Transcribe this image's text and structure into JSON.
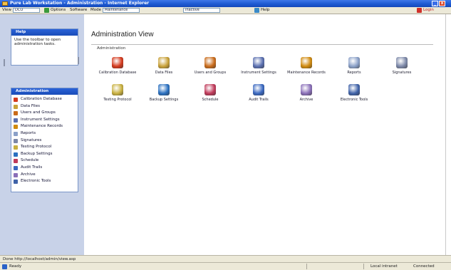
{
  "window": {
    "title": "Pure Lab Workstation - Administration - Internet Explorer",
    "buttons": [
      "_",
      "□",
      "x"
    ]
  },
  "toolbar": {
    "view_label": "View",
    "view_value": "DCO",
    "btn_options": "Options",
    "btn_software": "Software",
    "mode_label": "Mode",
    "mode_value": "Maintenance",
    "select2_value": "Inactive",
    "btn_help": "Help",
    "btn_login": "Login"
  },
  "left": {
    "panel1": {
      "title": "Help",
      "text": "Use the toolbar to open administration tasks."
    },
    "panel2": {
      "title": "Administration",
      "items": [
        {
          "label": "Calibration Database",
          "icon": "apple-icon",
          "color": "#d43a1e"
        },
        {
          "label": "Data Files",
          "icon": "folder-icon",
          "color": "#c9a23a"
        },
        {
          "label": "Users and Groups",
          "icon": "users-icon",
          "color": "#c96b1a"
        },
        {
          "label": "Instrument Settings",
          "icon": "instrument-icon",
          "color": "#5a6fb0"
        },
        {
          "label": "Maintenance Records",
          "icon": "maintenance-icon",
          "color": "#d08a0e"
        },
        {
          "label": "Reports",
          "icon": "report-icon",
          "color": "#8aa0c8"
        },
        {
          "label": "Signatures",
          "icon": "signature-icon",
          "color": "#7c88a8"
        },
        {
          "label": "Testing Protocol",
          "icon": "testing-icon",
          "color": "#c8b040"
        },
        {
          "label": "Backup Settings",
          "icon": "backup-icon",
          "color": "#2a70c0"
        },
        {
          "label": "Schedule",
          "icon": "calendar-icon",
          "color": "#c03a5a"
        },
        {
          "label": "Audit Trails",
          "icon": "audit-icon",
          "color": "#3a68c0"
        },
        {
          "label": "Archive",
          "icon": "archive-icon",
          "color": "#8a6fb8"
        },
        {
          "label": "Electronic Tools",
          "icon": "tools-icon",
          "color": "#3f62a8"
        }
      ]
    }
  },
  "main": {
    "page_title": "Administration View",
    "section_label": "Administration",
    "tiles": [
      {
        "label": "Calibration Database",
        "icon": "apple-icon",
        "color": "#d43a1e"
      },
      {
        "label": "Data Files",
        "icon": "folder-icon",
        "color": "#c9a23a"
      },
      {
        "label": "Users and Groups",
        "icon": "users-icon",
        "color": "#c96b1a"
      },
      {
        "label": "Instrument Settings",
        "icon": "instrument-icon",
        "color": "#5a6fb0"
      },
      {
        "label": "Maintenance Records",
        "icon": "maintenance-icon",
        "color": "#d08a0e"
      },
      {
        "label": "Reports",
        "icon": "report-icon",
        "color": "#8aa0c8"
      },
      {
        "label": "Signatures",
        "icon": "signature-icon",
        "color": "#7c88a8"
      },
      {
        "label": "Testing Protocol",
        "icon": "testing-icon",
        "color": "#c8b040"
      },
      {
        "label": "Backup Settings",
        "icon": "backup-icon",
        "color": "#2a70c0"
      },
      {
        "label": "Schedule",
        "icon": "calendar-icon",
        "color": "#c03a5a"
      },
      {
        "label": "Audit Trails",
        "icon": "audit-icon",
        "color": "#3a68c0"
      },
      {
        "label": "Archive",
        "icon": "archive-icon",
        "color": "#8a6fb8"
      },
      {
        "label": "Electronic Tools",
        "icon": "tools-icon",
        "color": "#3f62a8"
      }
    ]
  },
  "statusbar": {
    "line1": "Done  http://localhost/admin/view.asp",
    "line2_left": "Ready",
    "line2_mid": "Local intranet",
    "line2_right": "Connected"
  }
}
